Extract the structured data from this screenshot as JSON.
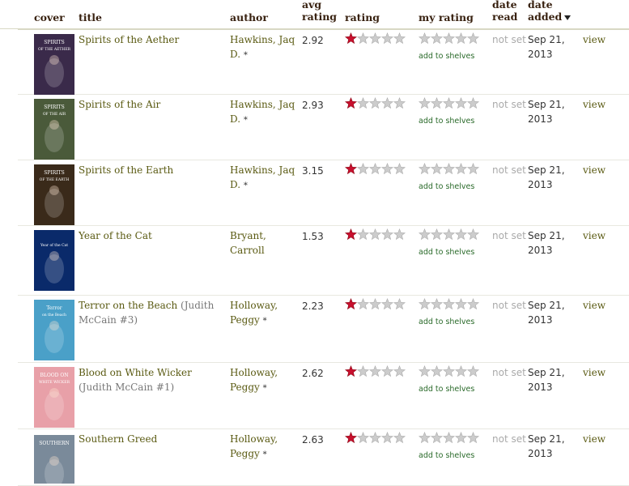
{
  "columns": {
    "cover": "cover",
    "title": "title",
    "author": "author",
    "avg_rating": "avg rating",
    "rating": "rating",
    "my_rating": "my rating",
    "date_read": "date read",
    "date_added": "date added"
  },
  "colors": {
    "star_filled": "#c8102e",
    "star_empty": "#cccccc",
    "link": "#5a5a12",
    "shelves_link": "#2a6a2a"
  },
  "rows": [
    {
      "title": "Spirits of the Aether",
      "series": "",
      "author_line1": "Hawkins, Jaq",
      "author_line2": "D.",
      "author_star": "*",
      "avg": "2.92",
      "rating_stars": 1,
      "my_rating_stars": 0,
      "add_label": "add to shelves",
      "date_read": "not set",
      "date_added_line1": "Sep 21,",
      "date_added_line2": "2013",
      "view": "view",
      "cover_text_1": "SPIRITS",
      "cover_text_2": "OF THE AETHER",
      "cover_bg": "#3a2a4a"
    },
    {
      "title": "Spirits of the Air",
      "series": "",
      "author_line1": "Hawkins, Jaq",
      "author_line2": "D.",
      "author_star": "*",
      "avg": "2.93",
      "rating_stars": 1,
      "my_rating_stars": 0,
      "add_label": "add to shelves",
      "date_read": "not set",
      "date_added_line1": "Sep 21,",
      "date_added_line2": "2013",
      "view": "view",
      "cover_text_1": "SPIRITS",
      "cover_text_2": "OF THE AIR",
      "cover_bg": "#4a5a3a"
    },
    {
      "title": "Spirits of the Earth",
      "series": "",
      "author_line1": "Hawkins, Jaq",
      "author_line2": "D.",
      "author_star": "*",
      "avg": "3.15",
      "rating_stars": 1,
      "my_rating_stars": 0,
      "add_label": "add to shelves",
      "date_read": "not set",
      "date_added_line1": "Sep 21,",
      "date_added_line2": "2013",
      "view": "view",
      "cover_text_1": "SPIRITS",
      "cover_text_2": "OF THE EARTH",
      "cover_bg": "#3a2a1a"
    },
    {
      "title": "Year of the Cat",
      "series": "",
      "author_line1": "Bryant, Carroll",
      "author_line2": "",
      "author_star": "",
      "avg": "1.53",
      "rating_stars": 1,
      "my_rating_stars": 0,
      "add_label": "add to shelves",
      "date_read": "not set",
      "date_added_line1": "Sep 21,",
      "date_added_line2": "2013",
      "view": "view",
      "cover_text_1": "",
      "cover_text_2": "Year of the Cat",
      "cover_bg": "#0a2a6a"
    },
    {
      "title": "Terror on the Beach",
      "series": "(Judith McCain #3)",
      "author_line1": "Holloway,",
      "author_line2": "Peggy",
      "author_star": "*",
      "avg": "2.23",
      "rating_stars": 1,
      "my_rating_stars": 0,
      "add_label": "add to shelves",
      "date_read": "not set",
      "date_added_line1": "Sep 21,",
      "date_added_line2": "2013",
      "view": "view",
      "cover_text_1": "Terror",
      "cover_text_2": "on the Beach",
      "cover_bg": "#4aa0c8"
    },
    {
      "title": "Blood on White Wicker",
      "series": "(Judith McCain #1)",
      "author_line1": "Holloway,",
      "author_line2": "Peggy",
      "author_star": "*",
      "avg": "2.62",
      "rating_stars": 1,
      "my_rating_stars": 0,
      "add_label": "add to shelves",
      "date_read": "not set",
      "date_added_line1": "Sep 21,",
      "date_added_line2": "2013",
      "view": "view",
      "cover_text_1": "BLOOD ON",
      "cover_text_2": "WHITE WICKER",
      "cover_bg": "#e8a0a8"
    },
    {
      "title": "Southern Greed",
      "series": "",
      "author_line1": "Holloway,",
      "author_line2": "Peggy",
      "author_star": "*",
      "avg": "2.63",
      "rating_stars": 1,
      "my_rating_stars": 0,
      "add_label": "add to shelves",
      "date_read": "not set",
      "date_added_line1": "Sep 21,",
      "date_added_line2": "2013",
      "view": "view",
      "cover_text_1": "SOUTHERN",
      "cover_text_2": "",
      "cover_bg": "#7a8a9a"
    }
  ]
}
